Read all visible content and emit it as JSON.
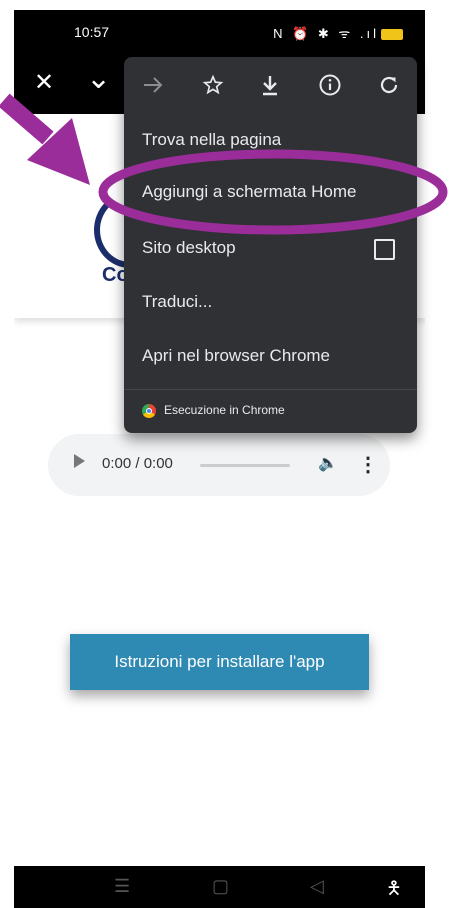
{
  "status_bar": {
    "time": "10:57",
    "icons": "N ⏰ ✱ ᯤ .ıl"
  },
  "toolbar": {
    "close_icon": "✕",
    "expand_icon": "⌄"
  },
  "page": {
    "logo_text": "Co",
    "audio": {
      "time": "0:00 / 0:00"
    },
    "install_button": "Istruzioni per installare l'app"
  },
  "menu": {
    "top_icons": [
      "forward-icon",
      "star-icon",
      "download-icon",
      "info-icon",
      "refresh-icon"
    ],
    "items": [
      {
        "label": "Trova nella pagina"
      },
      {
        "label": "Aggiungi a schermata Home"
      },
      {
        "label": "Sito desktop",
        "checked": false
      },
      {
        "label": "Traduci..."
      },
      {
        "label": "Apri nel browser Chrome"
      }
    ],
    "footer": "Esecuzione in Chrome"
  },
  "annotation": {
    "color": "#9b2d9b",
    "highlighted_item": "Aggiungi a schermata Home"
  },
  "nav_bar": {
    "icons": [
      "menu-icon",
      "home-icon",
      "back-icon",
      "accessibility-icon"
    ]
  }
}
